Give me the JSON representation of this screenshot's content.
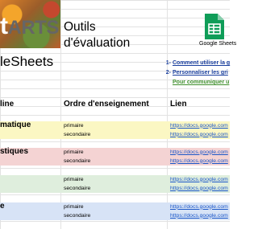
{
  "brand": {
    "logo_text": "ARTS",
    "logo_prefix": "t",
    "sheets_title": "leSheets"
  },
  "title": {
    "line1": "Outils",
    "line2": "d'évaluation"
  },
  "app_icon": {
    "name": "google-sheets-icon",
    "label": "Google Sheets",
    "color": "#0f9d58"
  },
  "links": [
    {
      "num": "1-",
      "text": "Comment utiliser la g",
      "color": "blue"
    },
    {
      "num": "2-",
      "text": "Personnaliser les gri",
      "color": "blue"
    },
    {
      "num": "",
      "text": "Pour communiquer u",
      "color": "green"
    }
  ],
  "table": {
    "headers": {
      "discipline": "line",
      "order": "Ordre d'enseignement",
      "link": "Lien"
    },
    "groups": [
      {
        "category": "matique",
        "color": "#fbf7c3",
        "rows": [
          {
            "order": "primaire",
            "url": "https://docs.google.com"
          },
          {
            "order": "secondaire",
            "url": "https://docs.google.com"
          }
        ]
      },
      {
        "category": "stiques",
        "color": "#f4d3d3",
        "rows": [
          {
            "order": "primaire",
            "url": "https://docs.google.com"
          },
          {
            "order": "secondaire",
            "url": "https://docs.google.com"
          }
        ]
      },
      {
        "category": "",
        "color": "#dfeedd",
        "rows": [
          {
            "order": "primaire",
            "url": "https://docs.google.com"
          },
          {
            "order": "secondaire",
            "url": "https://docs.google.com"
          }
        ]
      },
      {
        "category": "e",
        "color": "#d7e3f6",
        "rows": [
          {
            "order": "primaire",
            "url": "https://docs.google.com"
          },
          {
            "order": "secondaire",
            "url": "https://docs.google.com"
          }
        ]
      }
    ]
  }
}
